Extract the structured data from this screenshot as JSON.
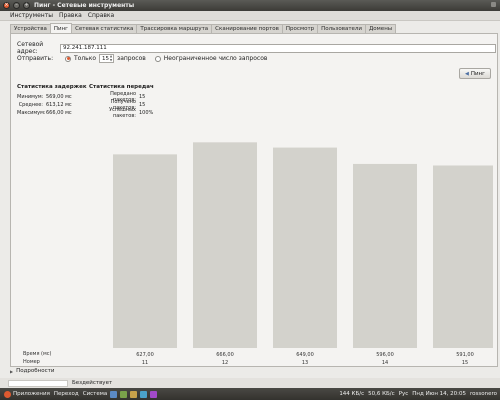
{
  "window": {
    "title": "Пинг - Сетевые инструменты"
  },
  "menu": [
    "Инструменты",
    "Правка",
    "Справка"
  ],
  "tabs": [
    "Устройства",
    "Пинг",
    "Сетевая статистика",
    "Трассировка маршрута",
    "Сканирование портов",
    "Просмотр",
    "Пользователи",
    "Домены"
  ],
  "form": {
    "address_label": "Сетевой адрес:",
    "address_value": "92.241.187.111",
    "send_label": "Отправить:",
    "only_label": "Только",
    "count_value": "15",
    "requests_label": "запросов",
    "unlimited_label": "Неограниченное число запросов",
    "ping_button": "Пинг"
  },
  "delay_stats": {
    "title": "Статистика задержек",
    "rows": [
      {
        "k": "Минимум:",
        "v": "569,00 мс"
      },
      {
        "k": "Среднее:",
        "v": "613,12 мс"
      },
      {
        "k": "Максимум:",
        "v": "666,00 мс"
      }
    ]
  },
  "transfer_stats": {
    "title": "Статистика передач",
    "rows": [
      {
        "k": "Передано пакетов:",
        "v": "15"
      },
      {
        "k": "Получено пакетов:",
        "v": "15"
      },
      {
        "k": "Успешных пакетов:",
        "v": "100%"
      }
    ]
  },
  "chart_data": {
    "type": "bar",
    "row_labels": [
      "Время (мс)",
      "Номер"
    ],
    "categories": [
      "11",
      "12",
      "13",
      "14",
      "15"
    ],
    "values": [
      627.0,
      666.0,
      649.0,
      596.0,
      591.0
    ],
    "value_labels": [
      "627,00",
      "666,00",
      "649,00",
      "596,00",
      "591,00"
    ],
    "color": "#d3d2cc"
  },
  "details_label": "Подробности",
  "status_text": "Бездействует",
  "taskbar": {
    "left": [
      "Приложения",
      "Переход",
      "Система"
    ],
    "right": [
      "144 КБ/с",
      "50,6 КБ/с",
      "Рус",
      "Пнд Июн 14, 20:05",
      "rossonero"
    ]
  }
}
